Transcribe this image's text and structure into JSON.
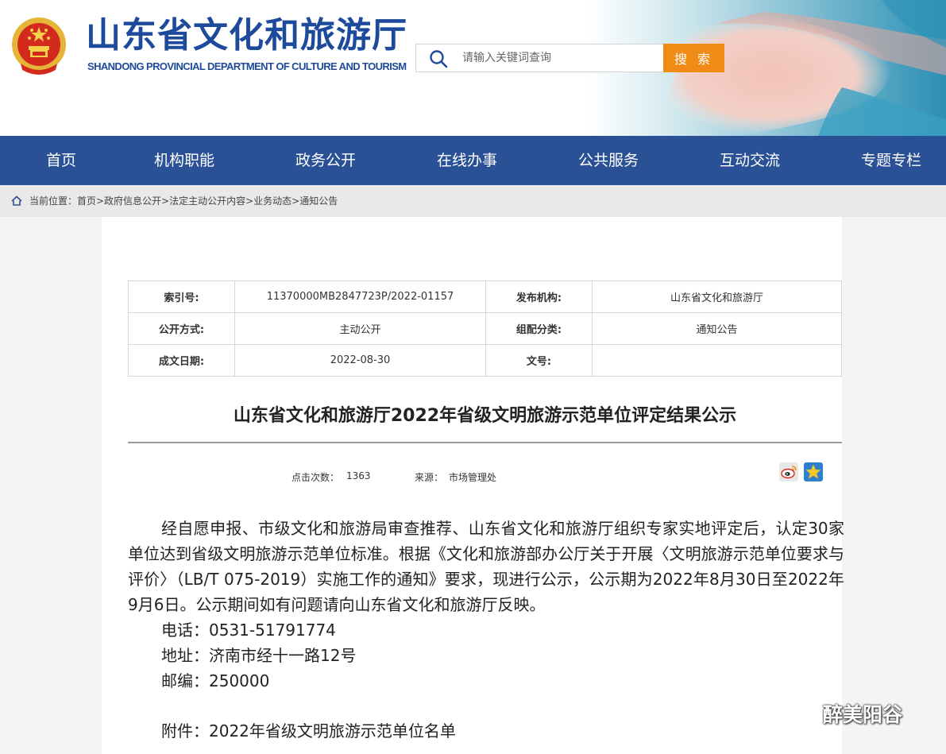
{
  "header": {
    "site_title": "山东省文化和旅游厅",
    "site_subtitle": "SHANDONG PROVINCIAL DEPARTMENT OF CULTURE AND TOURISM",
    "search_placeholder": "请输入关键词查询",
    "search_button": "搜 索"
  },
  "nav": {
    "items": [
      "首页",
      "机构职能",
      "政务公开",
      "在线办事",
      "公共服务",
      "互动交流",
      "专题专栏"
    ]
  },
  "breadcrumb": {
    "text": "当前位置：首页>政府信息公开>法定主动公开内容>业务动态>通知公告"
  },
  "meta": {
    "index_label": "索引号:",
    "index_value": "11370000MB2847723P/2022-01157",
    "publisher_label": "发布机构:",
    "publisher_value": "山东省文化和旅游厅",
    "method_label": "公开方式:",
    "method_value": "主动公开",
    "category_label": "组配分类:",
    "category_value": "通知公告",
    "date_label": "成文日期:",
    "date_value": "2022-08-30",
    "docno_label": "文号:",
    "docno_value": ""
  },
  "article": {
    "title": "山东省文化和旅游厅2022年省级文明旅游示范单位评定结果公示",
    "clicks_label": "点击次数：",
    "clicks_value": "1363",
    "source_label": "来源：",
    "source_value": "市场管理处",
    "paragraph": "经自愿申报、市级文化和旅游局审查推荐、山东省文化和旅游厅组织专家实地评定后，认定30家单位达到省级文明旅游示范单位标准。根据《文化和旅游部办公厅关于开展〈文明旅游示范单位要求与评价〉（LB/T 075-2019）实施工作的通知》要求，现进行公示，公示期为2022年8月30日至2022年9月6日。公示期间如有问题请向山东省文化和旅游厅反映。",
    "phone": "电话：0531-51791774",
    "address": "地址：济南市经十一路12号",
    "postcode": "邮编：250000",
    "attachment": "附件：2022年省级文明旅游示范单位名单"
  },
  "share": {
    "icons": [
      "weibo-icon",
      "qzone-icon"
    ]
  },
  "watermark": {
    "text": "醉美阳谷"
  },
  "colors": {
    "brand_blue": "#1d4a9a",
    "nav_blue": "#2a5195",
    "search_orange": "#f08b16"
  }
}
